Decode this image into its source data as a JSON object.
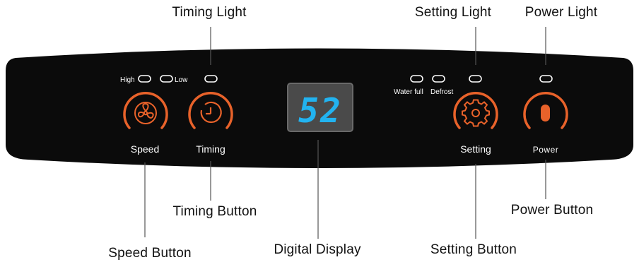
{
  "callouts": {
    "timing_light": "Timing Light",
    "setting_light": "Setting Light",
    "power_light": "Power Light",
    "timing_button": "Timing Button",
    "power_button": "Power Button",
    "speed_button": "Speed Button",
    "digital_display": "Digital Display",
    "setting_button": "Setting Button"
  },
  "panel": {
    "high": "High",
    "low": "Low",
    "water_full": "Water full",
    "defrost": "Defrost",
    "speed": "Speed",
    "timing": "Timing",
    "setting": "Setting",
    "power": "Power",
    "display_value": "52"
  },
  "colors": {
    "panel": "#0b0b0b",
    "accent": "#e8622a",
    "display_digits": "#22b3f0"
  },
  "icons": {
    "speed": "fan-icon",
    "timing": "clock-icon",
    "setting": "gear-icon",
    "power": "power-icon"
  }
}
